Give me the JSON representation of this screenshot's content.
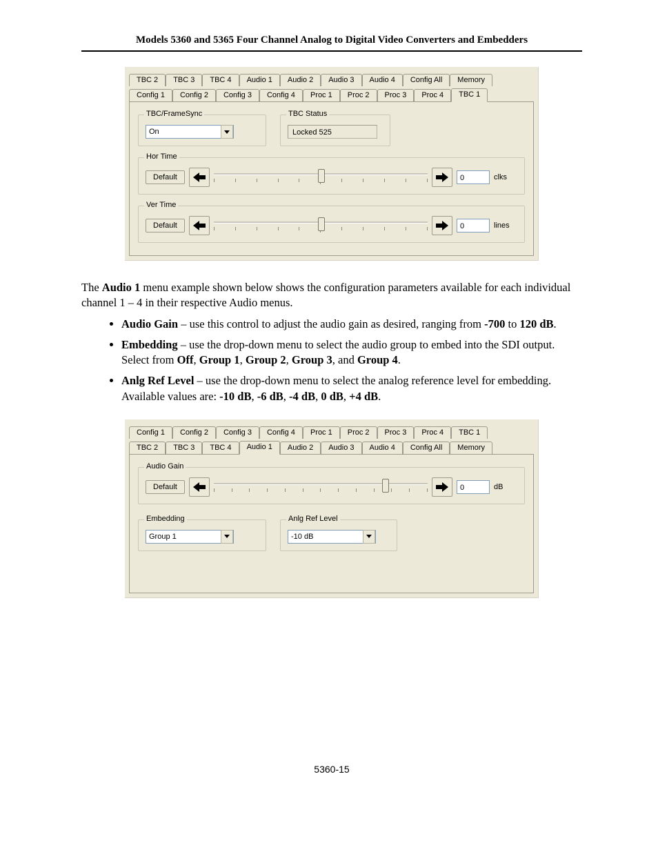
{
  "header": "Models 5360 and 5365 Four Channel Analog to Digital Video Converters and Embedders",
  "footer": "5360-15",
  "panel1": {
    "tabs_top": [
      "TBC 2",
      "TBC 3",
      "TBC 4",
      "Audio 1",
      "Audio 2",
      "Audio 3",
      "Audio 4",
      "Config All",
      "Memory"
    ],
    "tabs_bottom": [
      "Config 1",
      "Config 2",
      "Config 3",
      "Config 4",
      "Proc 1",
      "Proc 2",
      "Proc 3",
      "Proc 4",
      "TBC 1"
    ],
    "active_tab": "TBC 1",
    "framesync": {
      "legend": "TBC/FrameSync",
      "value": "On"
    },
    "tbcstatus": {
      "legend": "TBC Status",
      "value": "Locked 525"
    },
    "hor": {
      "legend": "Hor Time",
      "button": "Default",
      "value": "0",
      "unit": "clks",
      "thumb_pct": 50
    },
    "ver": {
      "legend": "Ver Time",
      "button": "Default",
      "value": "0",
      "unit": "lines",
      "thumb_pct": 50
    }
  },
  "paragraph": {
    "pre": "The ",
    "bold1": "Audio 1",
    "post": " menu example shown below shows the configuration parameters available for each individual channel 1 – 4 in their respective Audio menus."
  },
  "bullets": [
    {
      "b1": "Audio Gain",
      "t1": " – use this control to adjust the audio gain as desired, ranging from ",
      "b2": "-700",
      "t2": " to ",
      "b3": "120 dB",
      "t3": "."
    },
    {
      "b1": "Embedding",
      "t1": " – use the drop-down menu to select the audio group to embed into the SDI output. Select from ",
      "b2": "Off",
      "t2": ", ",
      "b3": "Group 1",
      "t3": ", ",
      "b4": "Group 2",
      "t4": ", ",
      "b5": "Group 3",
      "t5": ", and ",
      "b6": "Group 4",
      "t6": "."
    },
    {
      "b1": "Anlg Ref Level",
      "t1": " – use the drop-down menu to select the analog reference level for embedding. Available values are: ",
      "b2": "-10 dB",
      "t2": ", ",
      "b3": "-6 dB",
      "t3": ", ",
      "b4": "-4 dB",
      "t4": ", ",
      "b5": "0 dB",
      "t5": ", ",
      "b6": "+4 dB",
      "t6": "."
    }
  ],
  "panel2": {
    "tabs_top": [
      "Config 1",
      "Config 2",
      "Config 3",
      "Config 4",
      "Proc 1",
      "Proc 2",
      "Proc 3",
      "Proc 4",
      "TBC 1"
    ],
    "tabs_bottom": [
      "TBC 2",
      "TBC 3",
      "TBC 4",
      "Audio 1",
      "Audio 2",
      "Audio 3",
      "Audio 4",
      "Config All",
      "Memory"
    ],
    "active_tab": "Audio 1",
    "gain": {
      "legend": "Audio Gain",
      "button": "Default",
      "value": "0",
      "unit": "dB",
      "thumb_pct": 80
    },
    "embedding": {
      "legend": "Embedding",
      "value": "Group 1"
    },
    "anlgref": {
      "legend": "Anlg Ref Level",
      "value": "-10 dB"
    }
  }
}
